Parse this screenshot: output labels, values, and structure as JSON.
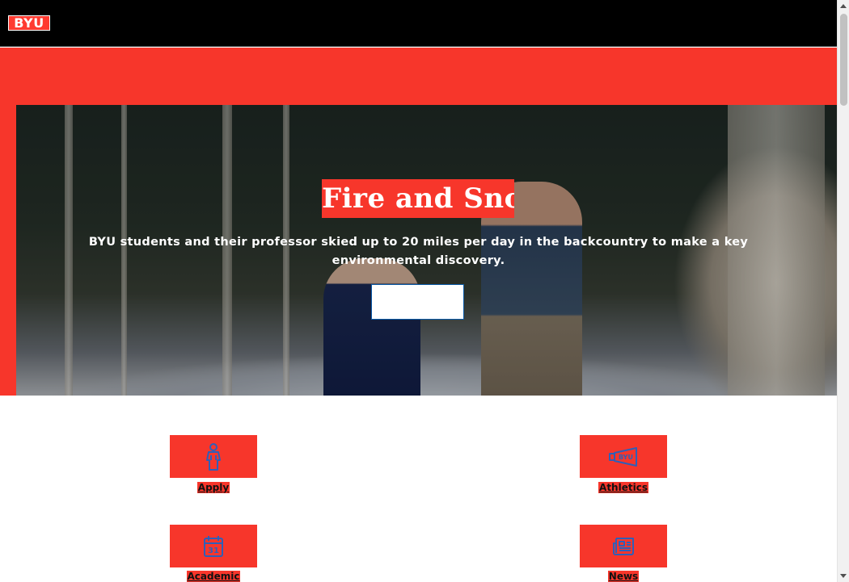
{
  "header": {
    "logo_text": "BYU"
  },
  "hero": {
    "title": "Fire and Snow",
    "subtitle": "BYU students and their professor skied up to 20 miles per day in the backcountry to make a key environmental discovery.",
    "button_label": ""
  },
  "tiles": [
    {
      "label": "Apply",
      "icon": "student-figure-icon"
    },
    {
      "label": "Athletics",
      "icon": "byu-megaphone-icon"
    },
    {
      "label": "Academic",
      "icon": "calendar-31-icon"
    },
    {
      "label": "News",
      "icon": "newspaper-icon"
    }
  ],
  "calendar_icon_text": "31",
  "megaphone_icon_text": "BYU",
  "colors": {
    "brand_red": "#f7362b",
    "header_black": "#000000",
    "icon_blue": "#2f5fb8"
  }
}
